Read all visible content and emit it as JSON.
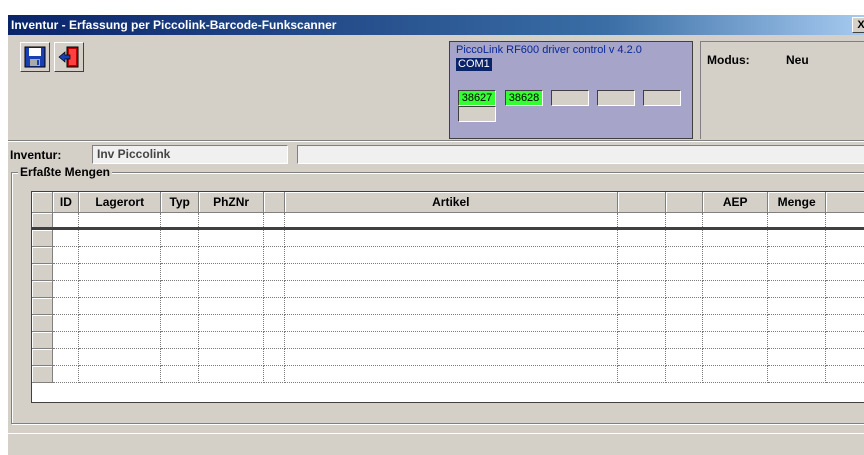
{
  "window": {
    "title": "Inventur - Erfassung per Piccolink-Barcode-Funkscanner",
    "close_label": "X"
  },
  "toolbar": {
    "buttons": [
      {
        "name": "save-button",
        "icon": "floppy-disk-icon"
      },
      {
        "name": "exit-button",
        "icon": "exit-door-icon"
      }
    ]
  },
  "piccolink": {
    "title": "PiccoLink RF600 driver control v 4.2.0",
    "port": "COM1",
    "slots": [
      {
        "label": "38627",
        "active": true
      },
      {
        "label": "38628",
        "active": true
      },
      {
        "label": "",
        "active": false
      },
      {
        "label": "",
        "active": false
      },
      {
        "label": "",
        "active": false
      },
      {
        "label": "",
        "active": false
      }
    ]
  },
  "modus": {
    "label": "Modus:",
    "value": "Neu"
  },
  "inventur": {
    "label": "Inventur:",
    "value": "Inv Piccolink",
    "extra": ""
  },
  "group": {
    "title": "Erfaßte Mengen"
  },
  "grid": {
    "columns": [
      "",
      "ID",
      "Lagerort",
      "Typ",
      "PhZNr",
      "",
      "Artikel",
      "",
      "",
      "AEP",
      "Menge",
      ""
    ],
    "row_count": 10
  },
  "colors": {
    "title_start": "#0a246a",
    "slot_active": "#33ff33",
    "panel": "#a6a4c8"
  }
}
